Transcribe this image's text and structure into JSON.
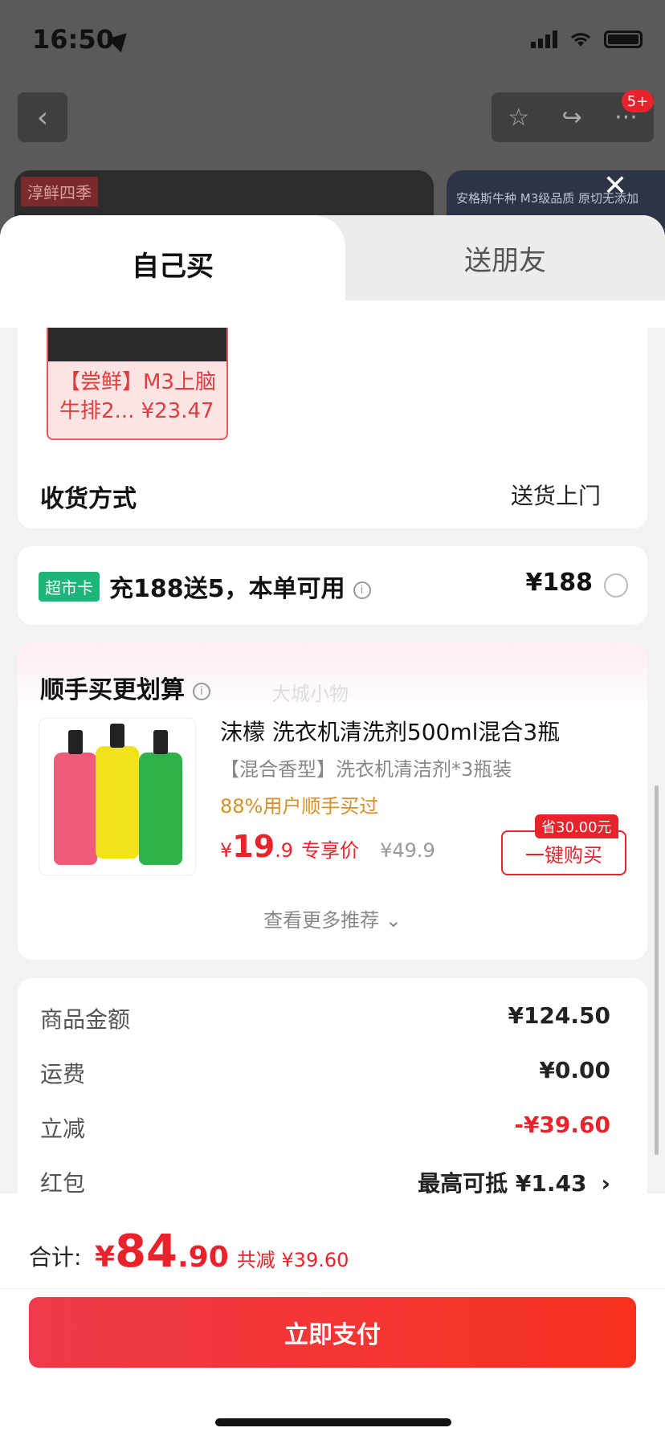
{
  "status_bar": {
    "time": "16:50"
  },
  "nav": {
    "back_icon": "‹",
    "star_icon": "☆",
    "share_icon": "↪",
    "more_icon": "···",
    "badge": "5+"
  },
  "background": {
    "banner_left_logo": "淳鲜四季",
    "banner_right_text": "安格斯牛种 M3级品质 原切无添加"
  },
  "tabs": {
    "self": "自己买",
    "friend": "送朋友"
  },
  "order_item": {
    "caption": "【尝鲜】M3上脑牛排2... ¥23.47"
  },
  "shipping": {
    "label": "收货方式",
    "value": "送货上门"
  },
  "card_offer": {
    "tag": "超市卡",
    "title": "充188送5，本单可用",
    "info": "i",
    "price": "¥188"
  },
  "upsell": {
    "title": "顺手买更划算",
    "info": "i",
    "watermark": "大城小物",
    "product": {
      "name": "沫檬 洗衣机清洗剂500ml混合3瓶",
      "subtitle": "【混合香型】洗衣机清洁剂*3瓶装",
      "rate": "88%用户顺手买过",
      "price_yen": "¥",
      "price_int": "19",
      "price_dec": ".9",
      "price_label": "专享价",
      "orig_price": "¥49.9",
      "save_tag": "省30.00元",
      "buy_button": "一键购买"
    },
    "more": "查看更多推荐 ⌄"
  },
  "summary": {
    "rows": [
      {
        "label": "商品金额",
        "value": "¥124.50"
      },
      {
        "label": "运费",
        "value": "¥0.00"
      },
      {
        "label": "立减",
        "value": "-¥39.60"
      },
      {
        "label": "红包",
        "value": "最高可抵 ¥1.43"
      }
    ],
    "chevron": "›"
  },
  "footer": {
    "total_label": "合计:",
    "total_yen": "¥",
    "total_int": "84",
    "total_dec": ".90",
    "total_saved": "共减 ¥39.60",
    "pay_button": "立即支付"
  },
  "colors": {
    "accent": "#e8232b",
    "green_tag": "#1fb47a",
    "rate": "#d4902a"
  }
}
